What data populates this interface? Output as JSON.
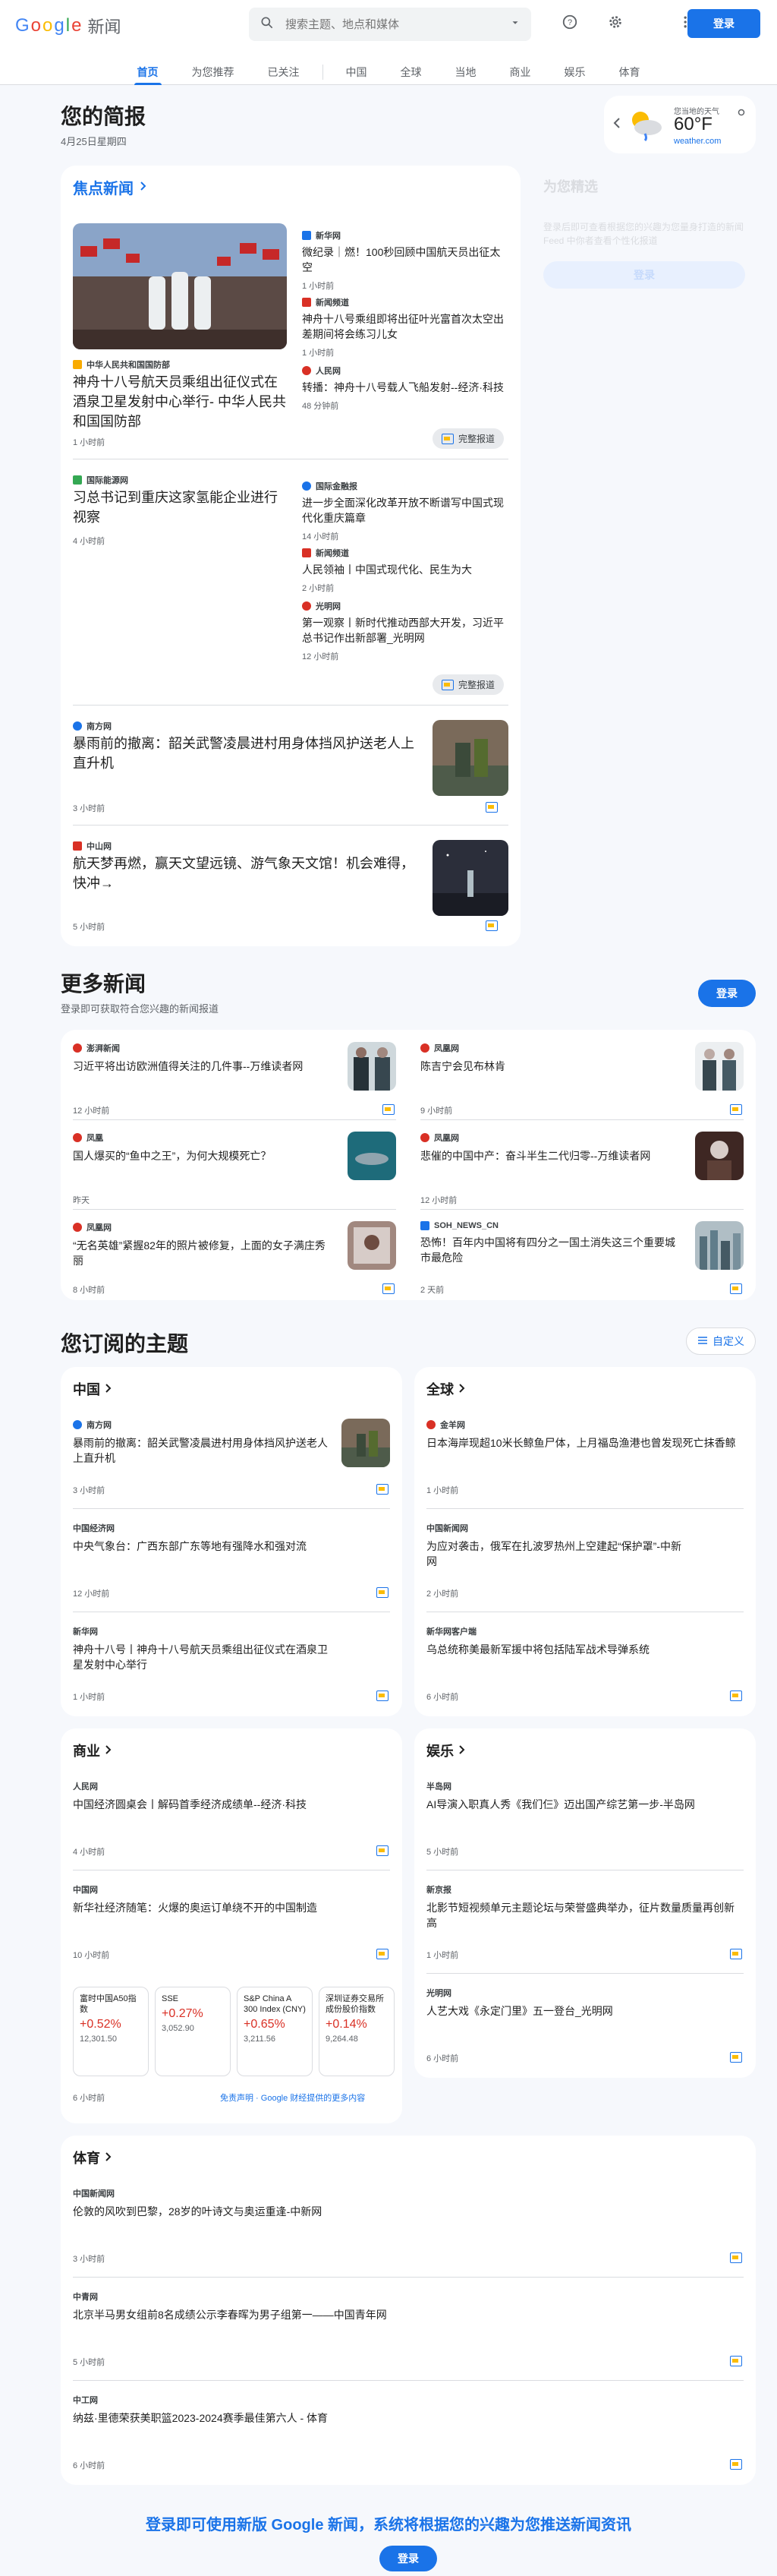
{
  "header": {
    "logo_letters": [
      "G",
      "o",
      "o",
      "g",
      "l",
      "e"
    ],
    "logo_suffix": "新闻",
    "search_placeholder": "搜索主题、地点和媒体",
    "signin": "登录"
  },
  "nav": {
    "tabs": [
      "首页",
      "为您推荐",
      "已关注",
      "中国",
      "全球",
      "当地",
      "商业",
      "娱乐",
      "体育"
    ],
    "active": "首页"
  },
  "briefing": {
    "title": "您的简报",
    "date": "4月25日星期四"
  },
  "weather": {
    "label": "您当地的天气",
    "temp": "60°F",
    "source": "weather.com"
  },
  "picks": {
    "title": "为您精选",
    "desc": "登录后即可查看根据您的兴趣为您量身打造的新闻 Feed 中你者查看个性化报道",
    "btn": "登录"
  },
  "headlines": {
    "title": "焦点新闻",
    "cluster1": {
      "main_source": "中华人民共和国国防部",
      "main_title": "神舟十八号航天员乘组出征仪式在酒泉卫星发射中心举行- 中华人民共和国国防部",
      "main_time": "1 小时前",
      "side": [
        {
          "source": "新华网",
          "title": "微纪录｜燃！100秒回顾中国航天员出征太空",
          "time": "1 小时前"
        },
        {
          "source": "新闻频道",
          "title": "神舟十八号乘组即将出征叶光富首次太空出差期间将会练习儿女",
          "time": "1 小时前"
        },
        {
          "source": "人民网",
          "title": "转播：神舟十八号载人飞船发射--经济·科技",
          "time": "48 分钟前"
        }
      ],
      "full": "完整报道"
    },
    "cluster2": {
      "main_source": "国际能源网",
      "main_title": "习总书记到重庆这家氢能企业进行视察",
      "main_time": "4 小时前",
      "side": [
        {
          "source": "国际金融报",
          "title": "进一步全面深化改革开放不断谱写中国式现代化重庆篇章",
          "time": "14 小时前"
        },
        {
          "source": "新闻频道",
          "title": "人民领袖丨中国式现代化、民生为大",
          "time": "2 小时前"
        },
        {
          "source": "光明网",
          "title": "第一观察丨新时代推动西部大开发，习近平总书记作出新部署_光明网",
          "time": "12 小时前"
        }
      ],
      "full": "完整报道"
    },
    "story3": {
      "source": "南方网",
      "title": "暴雨前的撤离：韶关武警凌晨进村用身体挡风护送老人上直升机",
      "time": "3 小时前"
    },
    "story4": {
      "source": "中山网",
      "title": "航天梦再燃，赢天文望远镜、游气象天文馆！机会难得，快冲→",
      "time": "5 小时前"
    }
  },
  "more": {
    "title": "更多新闻",
    "sub": "登录即可获取符合您兴趣的新闻报道",
    "btn": "登录",
    "items": [
      {
        "source": "澎湃新闻",
        "title": "习近平将出访欧洲值得关注的几件事--万维读者网",
        "time": "12 小时前"
      },
      {
        "source": "凤凰网",
        "title": "陈吉宁会见布林肯",
        "time": "9 小时前"
      },
      {
        "source": "凤凰",
        "title": "国人爆买的“鱼中之王”，为何大规模死亡？",
        "time": "昨天"
      },
      {
        "source": "凤凰网",
        "title": "悲催的中国中产：奋斗半生二代归零--万维读者网",
        "time": "12 小时前"
      },
      {
        "source": "凤凰网",
        "title": "“无名英雄”紧握82年的照片被修复，上面的女子满庄秀丽",
        "time": "8 小时前"
      },
      {
        "source": "SOH_NEWS_CN",
        "title": "恐怖！百年内中国将有四分之一国土消失这三个重要城市最危险",
        "time": "2 天前"
      }
    ]
  },
  "topics": {
    "title": "您订阅的主题",
    "customize": "自定义",
    "china": {
      "title": "中国",
      "items": [
        {
          "source": "南方网",
          "title": "暴雨前的撤离：韶关武警凌晨进村用身体挡风护送老人上直升机",
          "time": "3 小时前"
        },
        {
          "source": "中国经济网",
          "title": "中央气象台：广西东部广东等地有强降水和强对流",
          "time": "12 小时前"
        },
        {
          "source": "新华网",
          "title": "神舟十八号丨神舟十八号航天员乘组出征仪式在酒泉卫星发射中心举行",
          "time": "1 小时前"
        }
      ]
    },
    "world": {
      "title": "全球",
      "items": [
        {
          "source": "金羊网",
          "title": "日本海岸现超10米长鲸鱼尸体，上月福岛渔港也曾发现死亡抹香鲸",
          "time": "1 小时前"
        },
        {
          "source": "中国新闻网",
          "title": "为应对袭击，俄军在扎波罗热州上空建起“保护罩”-中新网",
          "time": "2 小时前"
        },
        {
          "source": "新华网客户端",
          "title": "乌总统称美最新军援中将包括陆军战术导弹系统",
          "time": "6 小时前"
        }
      ]
    },
    "business": {
      "title": "商业",
      "items": [
        {
          "source": "人民网",
          "title": "中国经济圆桌会丨解码首季经济成绩单--经济·科技",
          "time": "4 小时前"
        },
        {
          "source": "中国网",
          "title": "新华社经济随笔：火爆的奥运订单绕不开的中国制造",
          "time": "10 小时前"
        }
      ],
      "markets": [
        {
          "name": "富时中国A50指数",
          "pct": "+0.52%",
          "value": "12,301.50"
        },
        {
          "name": "SSE",
          "pct": "+0.27%",
          "value": "3,052.90"
        },
        {
          "name": "S&P China A 300 Index (CNY)",
          "pct": "+0.65%",
          "value": "3,211.56"
        },
        {
          "name": "深圳证券交易所成份股价指数",
          "pct": "+0.14%",
          "value": "9,264.48"
        }
      ],
      "foot_time": "6 小时前",
      "disclaimer": "免责声明 · Google 财经提供的更多内容"
    },
    "ent": {
      "title": "娱乐",
      "items": [
        {
          "source": "半岛网",
          "title": "AI导演入职真人秀《我们仨》迈出国产综艺第一步-半岛网",
          "time": "5 小时前"
        },
        {
          "source": "新京报",
          "title": "北影节短视频单元主题论坛与荣誉盛典举办，征片数量质量再创新高",
          "time": "1 小时前"
        },
        {
          "source": "光明网",
          "title": "人艺大戏《永定门里》五一登台_光明网",
          "time": "6 小时前"
        }
      ]
    },
    "sports": {
      "title": "体育",
      "items": [
        {
          "source": "中国新闻网",
          "title": "伦敦的风吹到巴黎，28岁的叶诗文与奥运重逢-中新网",
          "time": "3 小时前"
        },
        {
          "source": "中青网",
          "title": "北京半马男女组前8名成绩公示李春晖为男子组第一——中国青年网",
          "time": "5 小时前"
        },
        {
          "source": "中工网",
          "title": "纳兹·里德荣获美职篮2023-2024赛季最佳第六人 - 体育",
          "time": "6 小时前"
        }
      ]
    }
  },
  "footer": {
    "text": "登录即可使用新版 Google 新闻，系统将根据您的兴趣为您推送新闻资讯",
    "btn": "登录"
  }
}
